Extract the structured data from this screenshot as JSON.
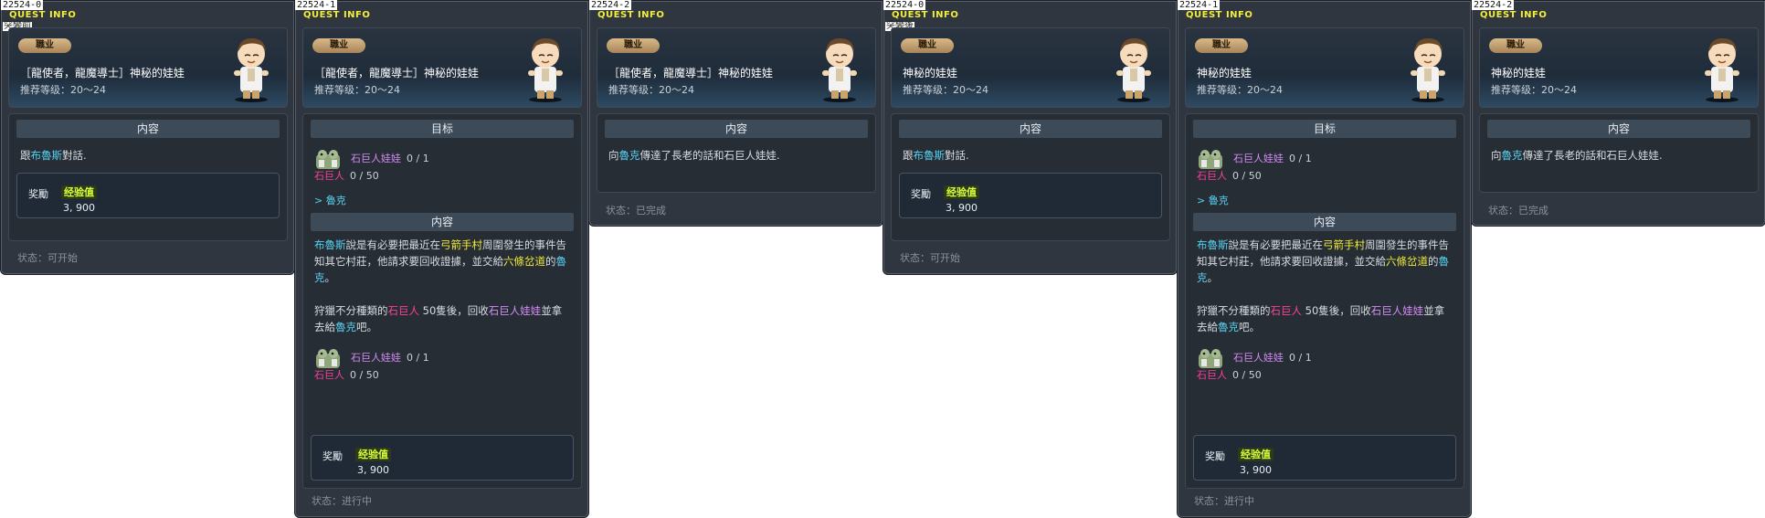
{
  "window_title": "QUEST INFO",
  "labels": {
    "job": "職业",
    "level": "推荐等级：20～24",
    "content": "内容",
    "goal": "目标",
    "reward": "奖勵",
    "exp": "经验值",
    "exp_value": "3, 900",
    "status_start": "状态：可开始",
    "status_progress": "状态：进行中",
    "status_done": "状态：已完成"
  },
  "windows": [
    {
      "id": "22524-0",
      "note": "突變前",
      "name": "［龍使者，龍魔導士］神秘的娃娃"
    },
    {
      "id": "22524-1",
      "note": "",
      "name": "［龍使者，龍魔導士］神秘的娃娃"
    },
    {
      "id": "22524-2",
      "note": "",
      "name": "［龍使者，龍魔導士］神秘的娃娃"
    },
    {
      "id": "22524-0",
      "note": "突變後",
      "name": "神秘的娃娃"
    },
    {
      "id": "22524-1",
      "note": "",
      "name": "神秘的娃娃"
    },
    {
      "id": "22524-2",
      "note": "",
      "name": "神秘的娃娃"
    }
  ],
  "text": {
    "talk_prefix": "跟",
    "talk_npc": "布魯斯",
    "talk_suffix": "對話.",
    "deliver_prefix": "向",
    "deliver_npc": "魯克",
    "deliver_suffix": "傳達了長老的話和石巨人娃娃.",
    "goal_item": "石巨人娃娃",
    "goal_item_count": "0 / 1",
    "goal_mob": "石巨人",
    "goal_mob_count": "0 / 50",
    "goal_npc": "> 魯克",
    "p1_a": "布魯斯",
    "p1_b": "說是有必要把最近在",
    "p1_c": "弓箭手村",
    "p1_d": "周圍發生的事件告知其它村莊，他請求要回收證據，並交給",
    "p1_e": "六條岔道",
    "p1_f": "的",
    "p1_g": "魯克",
    "p1_h": "。",
    "p2_a": "狩獵不分種類的",
    "p2_b": "石巨人",
    "p2_c": " 50隻後，回收",
    "p2_d": "石巨人娃娃",
    "p2_e": "並拿去給",
    "p2_f": "魯克",
    "p2_g": "吧。"
  },
  "colors": {
    "npc_highlight": "#57d1f0",
    "place_highlight": "#f0ea3a",
    "mob_highlight": "#ff3f97",
    "item_highlight": "#d58cf5",
    "title_yellow": "#f2ee3a"
  },
  "icons": {
    "npc_portrait": "npc-portrait-icon",
    "golem_doll": "golem-doll-icon"
  }
}
